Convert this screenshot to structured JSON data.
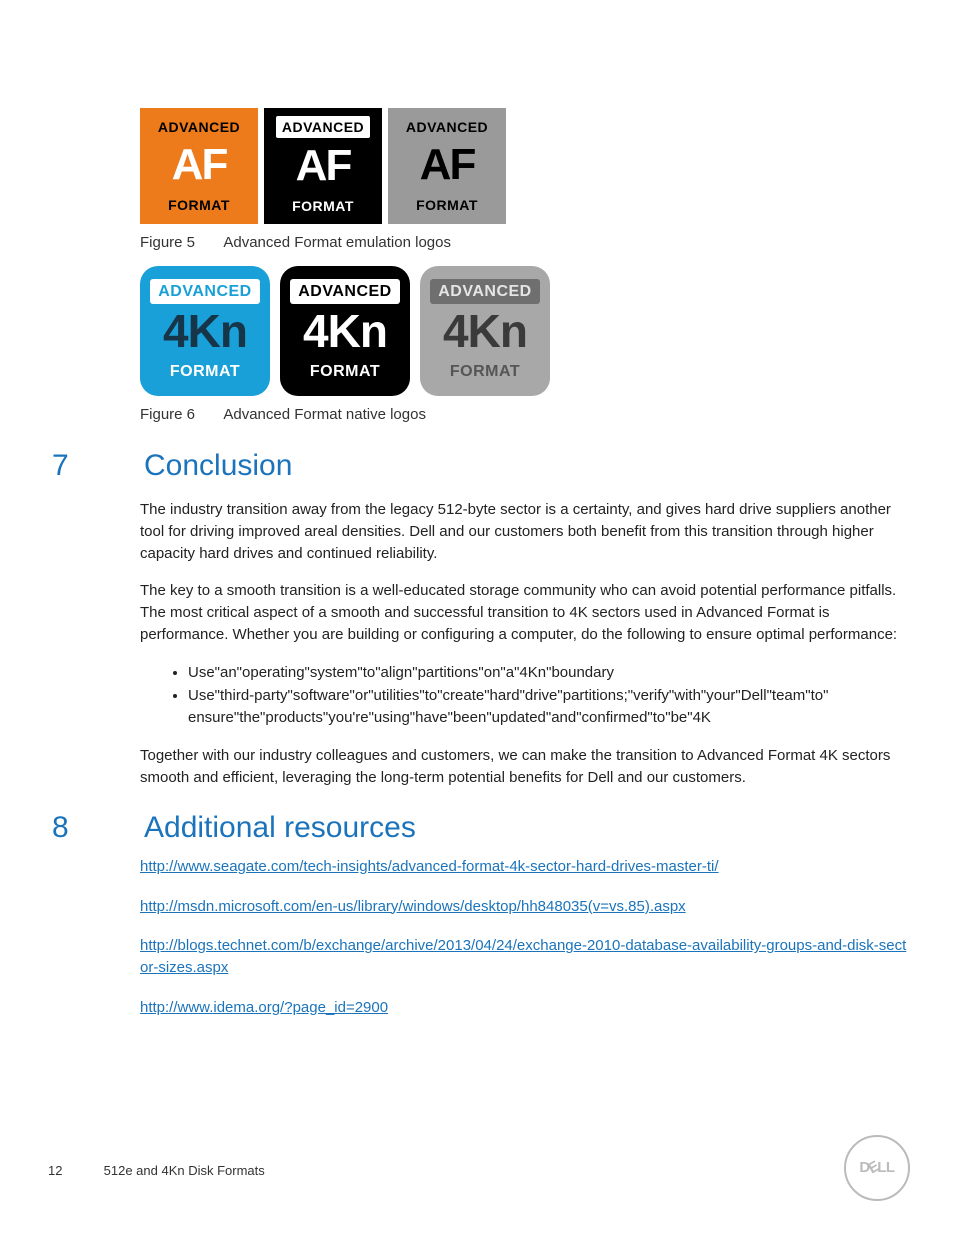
{
  "logos": {
    "af_top": "ADVANCED",
    "af_mid": "AF",
    "af_bot": "FORMAT",
    "kn_top": "ADVANCED",
    "kn_mid": "4Kn",
    "kn_bot": "FORMAT"
  },
  "fig5": {
    "label": "Figure 5",
    "caption": "Advanced Format emulation logos"
  },
  "fig6": {
    "label": "Figure 6",
    "caption": "Advanced Format native logos"
  },
  "sec7": {
    "num": "7",
    "title": "Conclusion",
    "p1": "The industry transition away from the legacy 512-byte sector is a certainty, and gives hard drive suppliers another tool for driving improved areal densities. Dell and our customers both benefit from this transition through higher capacity hard drives and continued reliability.",
    "p2": "The key to a smooth transition is a well-educated storage community who can avoid potential performance pitfalls. The most critical aspect of a smooth and successful transition to 4K sectors used in Advanced Format is performance. Whether you are building or configuring a computer, do the following to ensure optimal performance:",
    "b1": "Use\"an\"operating\"system\"to\"align\"partitions\"on\"a\"4Kn\"boundary",
    "b2": "Use\"third-party\"software\"or\"utilities\"to\"create\"hard\"drive\"partitions;\"verify\"with\"your\"Dell\"team\"to\" ensure\"the\"products\"you're\"using\"have\"been\"updated\"and\"confirmed\"to\"be\"4K",
    "p3": "Together with our industry colleagues and customers, we can make the transition to Advanced Format 4K sectors smooth and efficient, leveraging the long-term potential benefits for Dell and our customers."
  },
  "sec8": {
    "num": "8",
    "title": "Additional resources",
    "links": {
      "l1": "http://www.seagate.com/tech-insights/advanced-format-4k-sector-hard-drives-master-ti/",
      "l2": "http://msdn.microsoft.com/en-us/library/windows/desktop/hh848035(v=vs.85).aspx",
      "l3": "http://blogs.technet.com/b/exchange/archive/2013/04/24/exchange-2010-database-availability-groups-and-disk-sector-sizes.aspx",
      "l4": "http://www.idema.org/?page_id=2900"
    }
  },
  "footer": {
    "page": "12",
    "title": "512e and 4Kn Disk Formats"
  },
  "dell": {
    "d": "D",
    "e": "E",
    "l1": "L",
    "l2": "L"
  }
}
